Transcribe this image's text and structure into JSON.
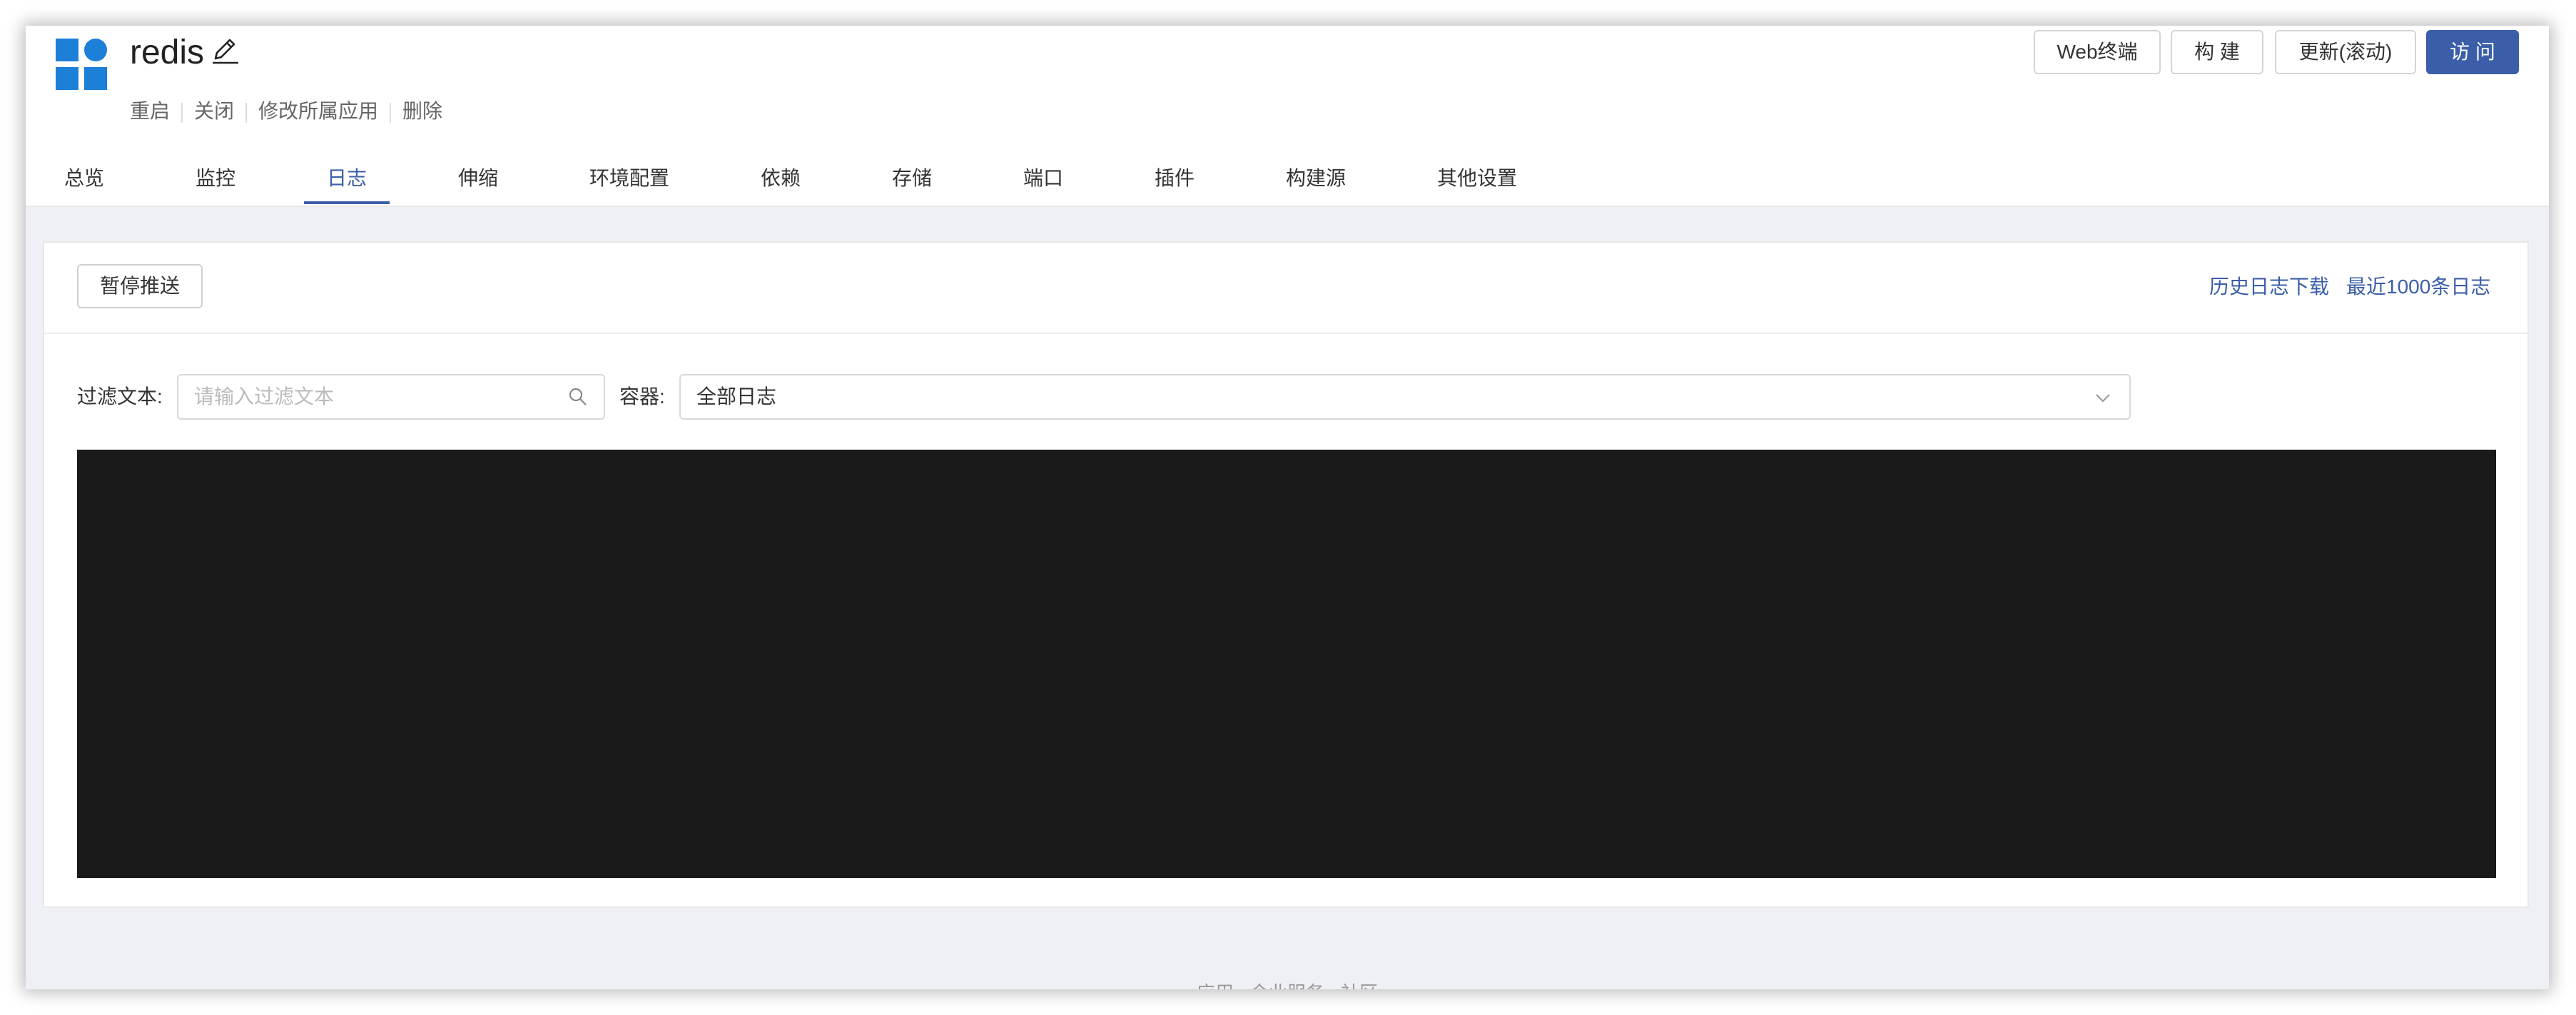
{
  "app": {
    "title": "redis",
    "actions": [
      "重启",
      "关闭",
      "修改所属应用",
      "删除"
    ]
  },
  "header_buttons": {
    "web_terminal": "Web终端",
    "build": "构 建",
    "update": "更新(滚动)",
    "visit": "访 问"
  },
  "tabs": [
    "总览",
    "监控",
    "日志",
    "伸缩",
    "环境配置",
    "依赖",
    "存储",
    "端口",
    "插件",
    "构建源",
    "其他设置"
  ],
  "active_tab": "日志",
  "log_panel": {
    "pause_button": "暂停推送",
    "history_download": "历史日志下载",
    "recent_logs": "最近1000条日志",
    "filter_label": "过滤文本:",
    "filter_placeholder": "请输入过滤文本",
    "filter_value": "",
    "container_label": "容器:",
    "container_selected": "全部日志"
  },
  "footer": {
    "text": "应用 · 企业服务 · 社区"
  },
  "colors": {
    "primary": "#3b5ea8",
    "logo": "#1c7fd8",
    "log_background": "#1a1a1a",
    "page_background": "#eef0f5"
  }
}
